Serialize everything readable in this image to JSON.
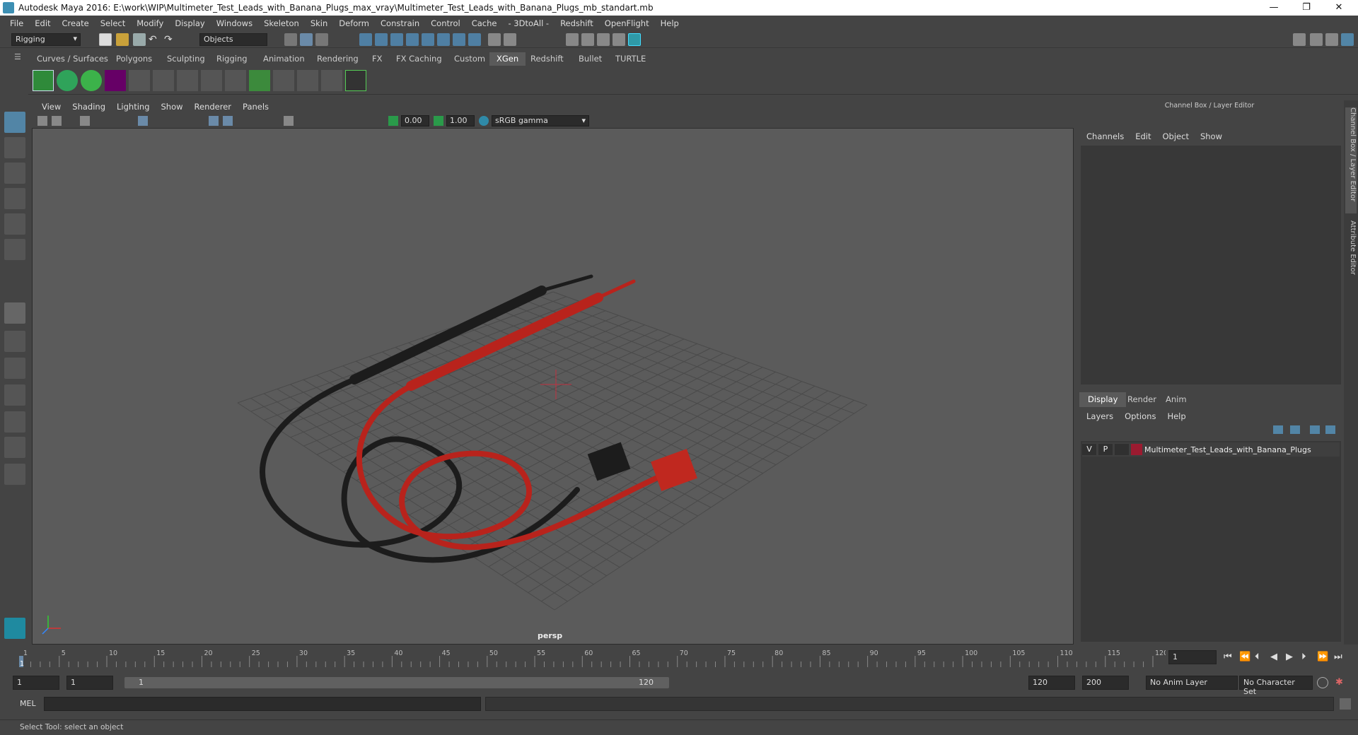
{
  "window": {
    "title": "Autodesk Maya 2016: E:\\work\\WIP\\Multimeter_Test_Leads_with_Banana_Plugs_max_vray\\Multimeter_Test_Leads_with_Banana_Plugs_mb_standart.mb",
    "minimize": "—",
    "restore": "❐",
    "close": "✕"
  },
  "menubar": [
    "File",
    "Edit",
    "Create",
    "Select",
    "Modify",
    "Display",
    "Windows",
    "Skeleton",
    "Skin",
    "Deform",
    "Constrain",
    "Control",
    "Cache",
    "- 3DtoAll -",
    "Redshift",
    "OpenFlight",
    "Help"
  ],
  "toolbar": {
    "menuset": "Rigging",
    "selection_mode": "Objects"
  },
  "shelf_tabs": [
    "Curves / Surfaces",
    "Polygons",
    "Sculpting",
    "Rigging",
    "Animation",
    "Rendering",
    "FX",
    "FX Caching",
    "Custom",
    "XGen",
    "Redshift",
    "Bullet",
    "TURTLE"
  ],
  "active_shelf_tab": "XGen",
  "viewport": {
    "menu": [
      "View",
      "Shading",
      "Lighting",
      "Show",
      "Renderer",
      "Panels"
    ],
    "exposure": "0.00",
    "gamma": "1.00",
    "color_space": "sRGB gamma",
    "camera_label": "persp"
  },
  "right_panel": {
    "title": "Channel Box / Layer Editor",
    "channel_menu": [
      "Channels",
      "Edit",
      "Object",
      "Show"
    ],
    "layer_tabs": [
      "Display",
      "Render",
      "Anim"
    ],
    "active_layer_tab": "Display",
    "layer_menu": [
      "Layers",
      "Options",
      "Help"
    ],
    "layers": [
      {
        "visible": "V",
        "playback": "P",
        "name": "Multimeter_Test_Leads_with_Banana_Plugs",
        "color": "#9b1b30"
      }
    ]
  },
  "side_tabs": [
    "Channel Box / Layer Editor",
    "Attribute Editor"
  ],
  "timeline": {
    "ticks": [
      "1",
      "5",
      "10",
      "15",
      "20",
      "25",
      "30",
      "35",
      "40",
      "45",
      "50",
      "55",
      "60",
      "65",
      "70",
      "75",
      "80",
      "85",
      "90",
      "95",
      "100",
      "105",
      "110",
      "115",
      "120"
    ],
    "current_frame": "1",
    "current_frame_field": "1"
  },
  "range": {
    "start": "1",
    "playback_start": "1",
    "slider_start": "1",
    "slider_end": "120",
    "playback_end": "120",
    "end": "200",
    "anim_layer": "No Anim Layer",
    "character_set": "No Character Set"
  },
  "command_line": {
    "label": "MEL"
  },
  "help_line": "Select Tool: select an object",
  "colors": {
    "accent": "#5285a6",
    "red_lead": "#b8231c",
    "black_lead": "#1c1c1c"
  }
}
